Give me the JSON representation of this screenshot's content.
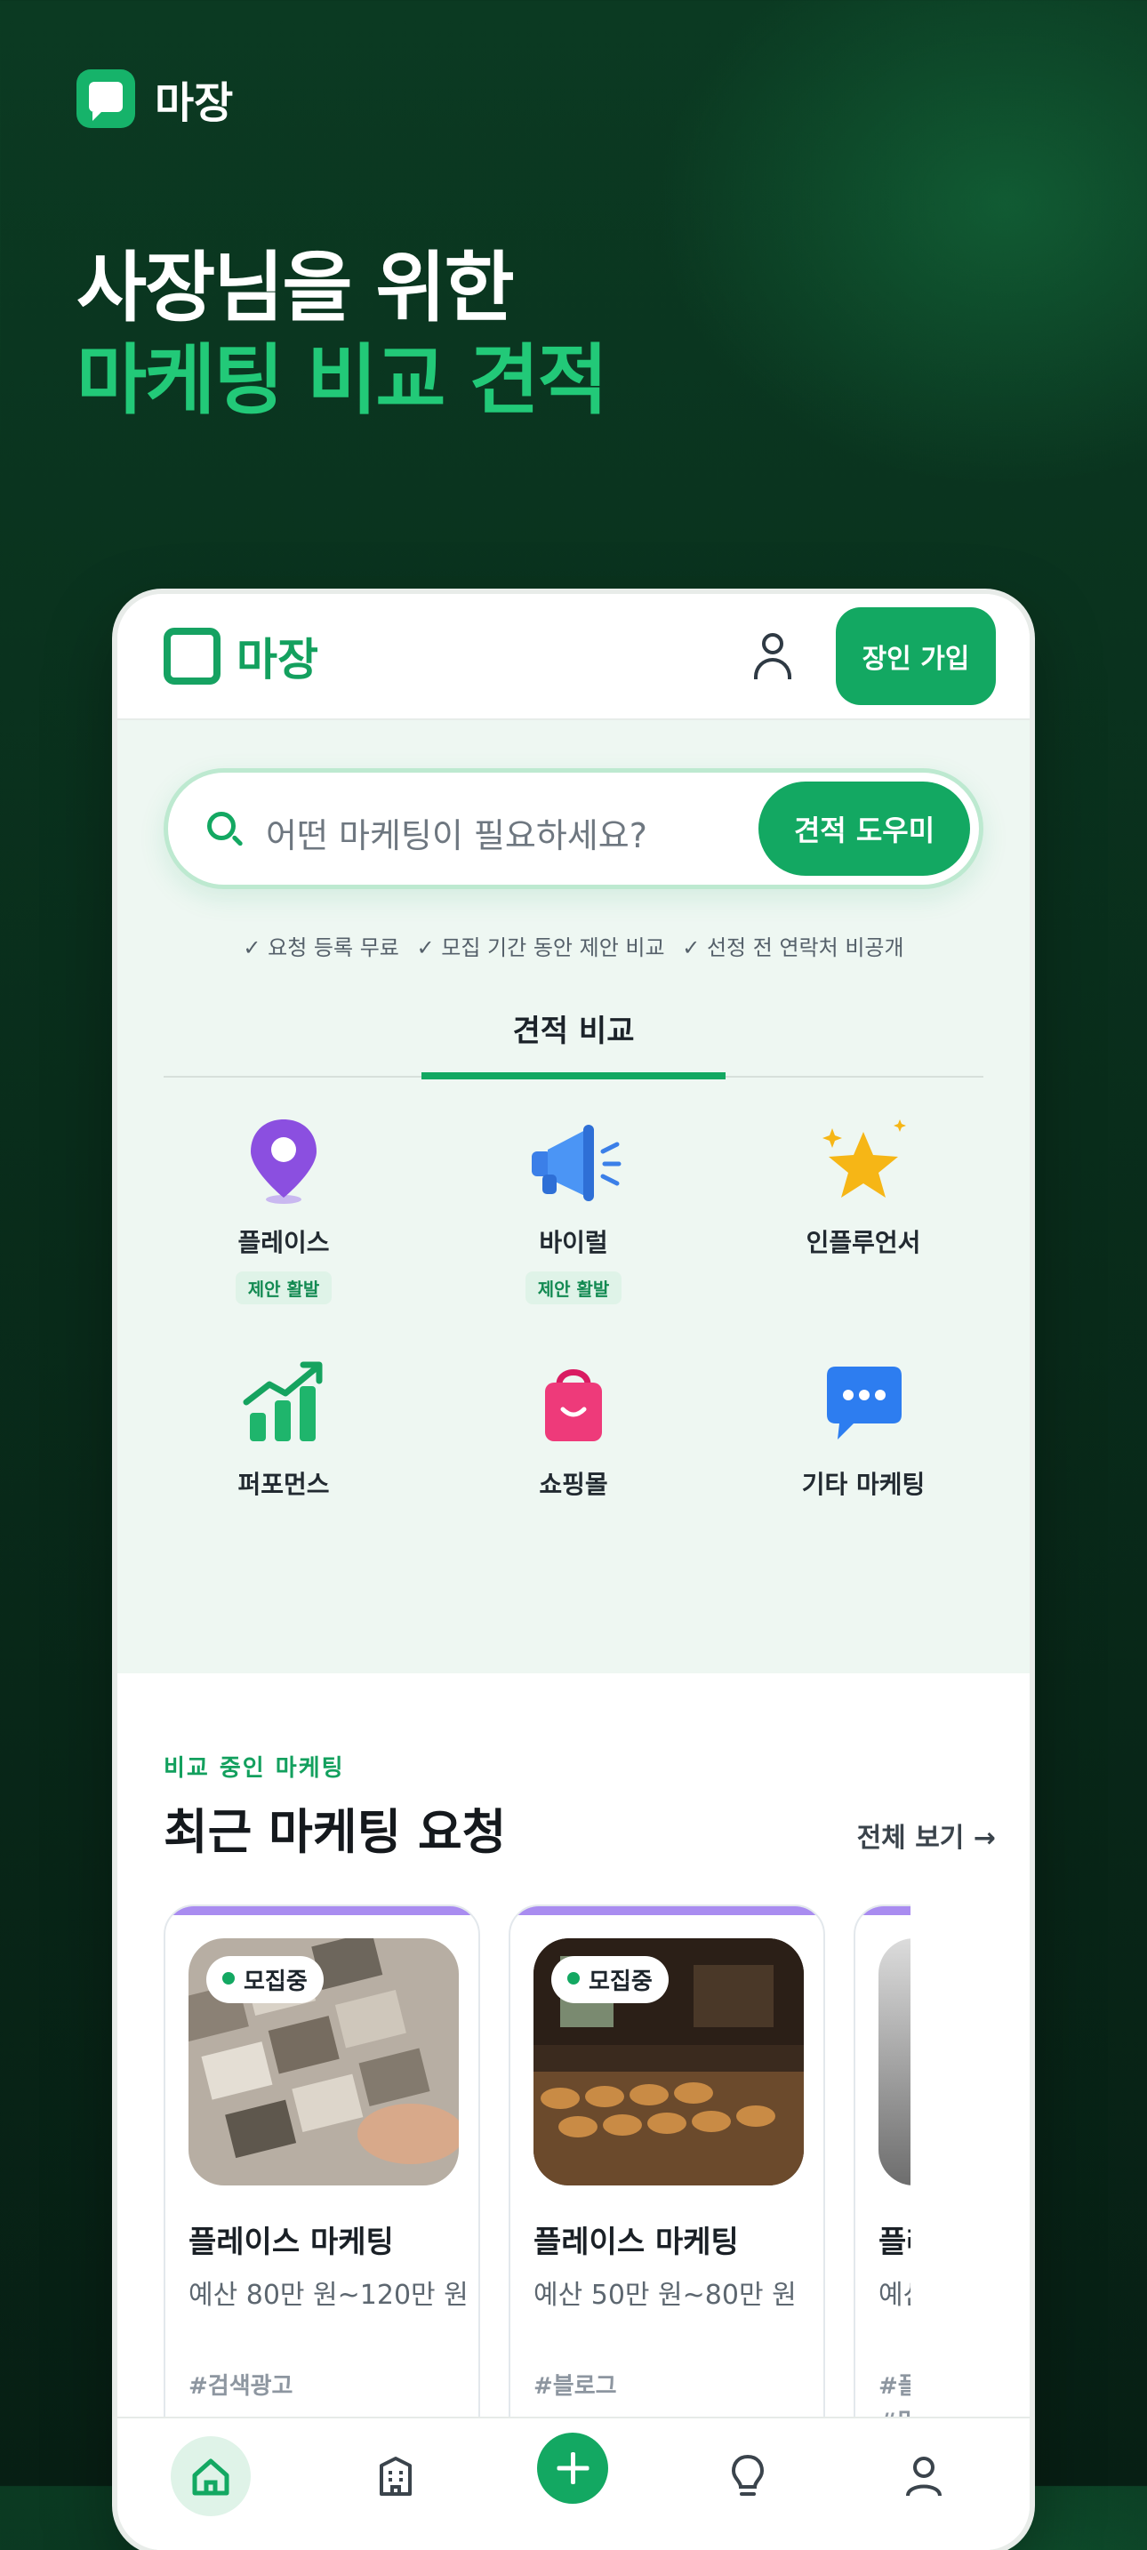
{
  "brand": {
    "name": "마장"
  },
  "headline": {
    "line1": "사장님을 위한",
    "line2": "마케팅 비교 견적"
  },
  "app": {
    "logo_name": "마장",
    "signup_label": "장인 가입",
    "search": {
      "placeholder": "어떤 마케팅이 필요하세요?",
      "cta": "견적 도우미"
    },
    "benefits": [
      "✓ 요청 등록 무료",
      "✓ 모집 기간 동안 제안 비교",
      "✓ 선정 전 연락처 비공개"
    ],
    "tab_active": "견적 비교",
    "categories": [
      {
        "name": "플레이스",
        "badge": "제안 활발",
        "icon": "map-pin-icon"
      },
      {
        "name": "바이럴",
        "badge": "제안 활발",
        "icon": "megaphone-icon"
      },
      {
        "name": "인플루언서",
        "badge": "",
        "icon": "star-icon"
      },
      {
        "name": "퍼포먼스",
        "badge": "",
        "icon": "growth-chart-icon"
      },
      {
        "name": "쇼핑몰",
        "badge": "",
        "icon": "shopping-bag-icon"
      },
      {
        "name": "기타 마케팅",
        "badge": "",
        "icon": "chat-bubble-icon"
      }
    ],
    "recent": {
      "eyebrow": "비교 중인 마케팅",
      "title": "최근 마케팅 요청",
      "see_all": "전체 보기 →",
      "cards": [
        {
          "status": "모집중",
          "title": "플레이스 마케팅",
          "budget": "예산 80만 원~120만 원",
          "tags": [
            "#검색광고"
          ]
        },
        {
          "status": "모집중",
          "title": "플레이스 마케팅",
          "budget": "예산 50만 원~80만 원",
          "tags": [
            "#블로그"
          ]
        },
        {
          "status": "",
          "title": "플레",
          "budget": "예산",
          "tags": [
            "#플레",
            "#맛집"
          ]
        }
      ]
    },
    "bottom_nav": [
      "home-icon",
      "building-icon",
      "plus-icon",
      "lightbulb-icon",
      "profile-icon"
    ]
  },
  "colors": {
    "brand_green": "#13a862",
    "accent_green": "#22c978",
    "card_accent": "#a98cf0"
  }
}
